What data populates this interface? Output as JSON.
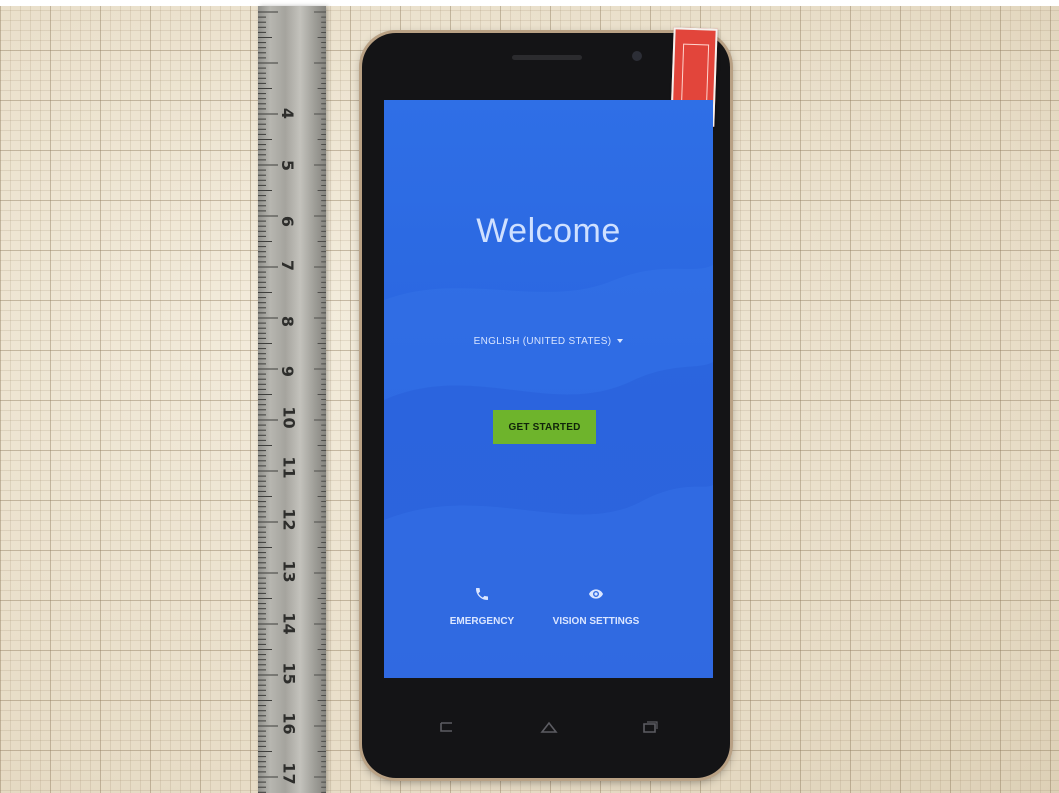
{
  "screen": {
    "title": "Welcome",
    "language_selector": "ENGLISH (UNITED STATES)",
    "start_button": "GET STARTED",
    "emergency_label": "EMERGENCY",
    "vision_label": "VISION SETTINGS"
  },
  "ruler": {
    "numbers": [
      "4",
      "5",
      "6",
      "7",
      "8",
      "9",
      "10",
      "11",
      "12",
      "13",
      "14",
      "15",
      "16",
      "17"
    ]
  },
  "icons": {
    "emergency": "phone-icon",
    "vision": "eye-icon",
    "back": "back-key-icon",
    "home": "home-key-icon",
    "recents": "recents-key-icon"
  },
  "colors": {
    "screen_blue": "#2f6fe6",
    "button_green": "#6eb42c",
    "sticker_red": "#e2453b",
    "phone_bezel": "#141416"
  }
}
